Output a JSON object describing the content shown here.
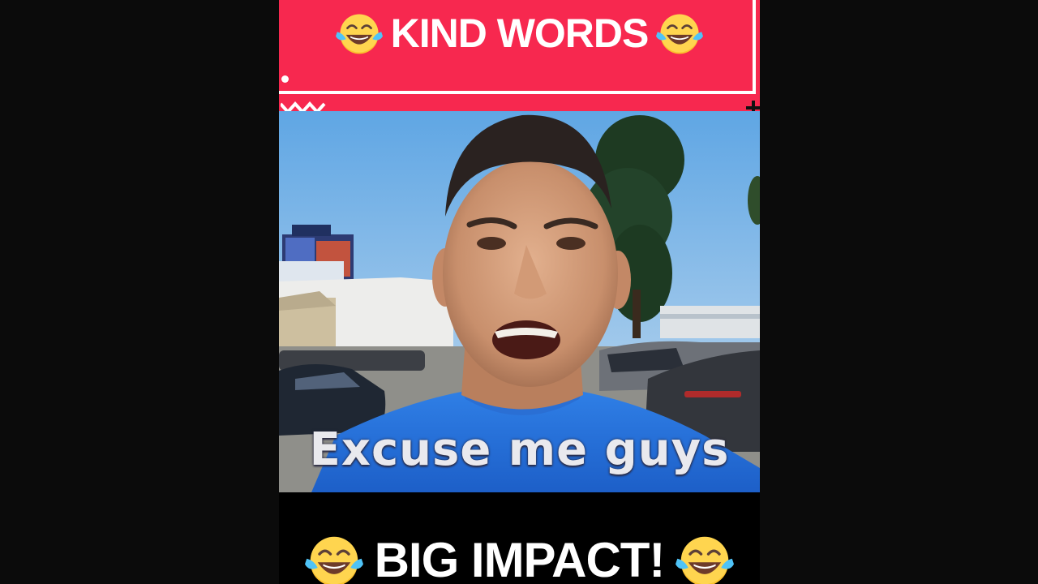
{
  "banner": {
    "title": "KIND WORDS",
    "left_icon": "face-with-tears-of-joy-icon",
    "right_icon": "face-with-tears-of-joy-icon",
    "color": "#f7284f"
  },
  "video": {
    "caption": "Excuse me guys"
  },
  "footer": {
    "title": "BIG IMPACT!",
    "left_icon": "face-with-tears-of-joy-icon",
    "right_icon": "face-with-tears-of-joy-icon"
  }
}
